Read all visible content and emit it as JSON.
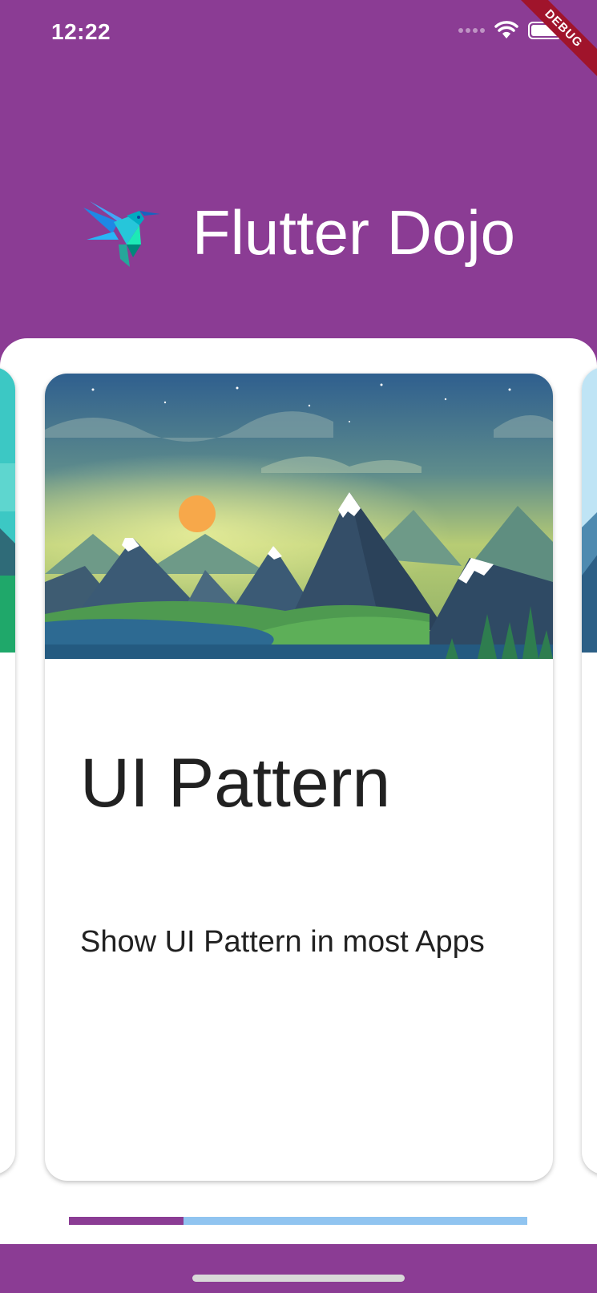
{
  "status_bar": {
    "time": "12:22",
    "icons": [
      "signal-dots-icon",
      "wifi-icon",
      "battery-icon"
    ]
  },
  "debug_banner": {
    "label": "DEBUG",
    "color": "#A0142B"
  },
  "header": {
    "title": "Flutter Dojo",
    "logo_icon": "hummingbird-logo-icon",
    "background": "#8B3C94"
  },
  "cards": {
    "current": {
      "title": "UI Pattern",
      "description": "Show UI Pattern in most Apps",
      "image_icon": "mountain-landscape-illustration"
    }
  },
  "page_indicator": {
    "progress": 0.25,
    "fill_color": "#8B3C94",
    "track_color": "#90C4F0"
  }
}
